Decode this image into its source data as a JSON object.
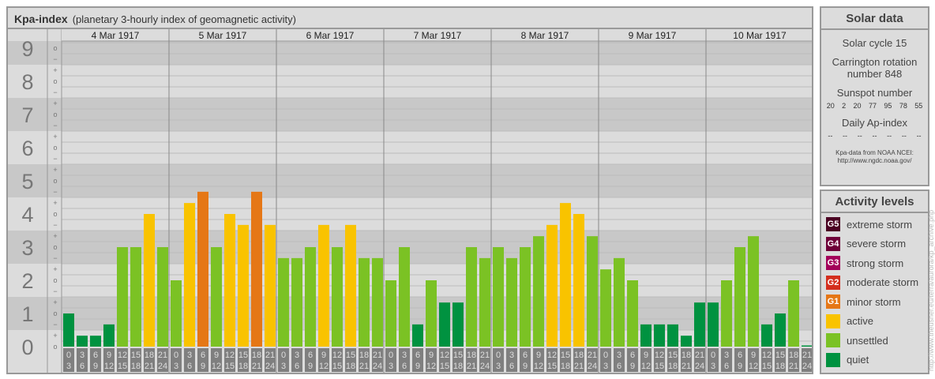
{
  "header": {
    "title": "Kpa-index",
    "subtitle": "(planetary 3-hourly index of geomagnetic activity)"
  },
  "chart_data": {
    "type": "bar",
    "title": "Kpa-index",
    "ylim": [
      0,
      9
    ],
    "y_ticks": [
      "0",
      "1",
      "2",
      "3",
      "4",
      "5",
      "6",
      "7",
      "8",
      "9"
    ],
    "y_subticks": [
      "o",
      "+",
      "−"
    ],
    "days": [
      "4 Mar 1917",
      "5 Mar 1917",
      "6 Mar 1917",
      "7 Mar 1917",
      "8 Mar 1917",
      "9 Mar 1917",
      "10 Mar 1917"
    ],
    "hour_labels": [
      [
        "0",
        "3"
      ],
      [
        "3",
        "6"
      ],
      [
        "6",
        "9"
      ],
      [
        "9",
        "12"
      ],
      [
        "12",
        "15"
      ],
      [
        "15",
        "18"
      ],
      [
        "18",
        "21"
      ],
      [
        "21",
        "24"
      ]
    ],
    "values": [
      [
        1.0,
        0.33,
        0.33,
        0.67,
        3.0,
        3.0,
        4.0,
        3.0
      ],
      [
        2.0,
        4.33,
        4.67,
        3.0,
        4.0,
        3.67,
        4.67,
        3.67
      ],
      [
        2.67,
        2.67,
        3.0,
        3.67,
        3.0,
        3.67,
        2.67,
        2.67
      ],
      [
        2.0,
        3.0,
        0.67,
        2.0,
        1.33,
        1.33,
        3.0,
        2.67
      ],
      [
        3.0,
        2.67,
        3.0,
        3.33,
        3.67,
        4.33,
        4.0,
        3.33
      ],
      [
        2.33,
        2.67,
        2.0,
        0.67,
        0.67,
        0.67,
        0.33,
        1.33
      ],
      [
        1.33,
        2.0,
        3.0,
        3.33,
        0.67,
        1.0,
        2.0,
        0.0
      ]
    ]
  },
  "solar": {
    "title": "Solar data",
    "cycle": "Solar cycle 15",
    "carrington": "Carrington rotation number 848",
    "sunspot_label": "Sunspot number",
    "sunspots": [
      "20",
      "2",
      "20",
      "77",
      "95",
      "78",
      "55"
    ],
    "ap_label": "Daily Ap-index",
    "ap": [
      "--",
      "--",
      "--",
      "--",
      "--",
      "--",
      "--"
    ],
    "source1": "Kpa-data from NOAA NCEI:",
    "source2": "http://www.ngdc.noaa.gov/"
  },
  "legend": {
    "title": "Activity levels",
    "items": [
      {
        "badge": "G5",
        "label": "extreme storm",
        "color": "#4a0022"
      },
      {
        "badge": "G4",
        "label": "severe storm",
        "color": "#6e0038"
      },
      {
        "badge": "G3",
        "label": "strong storm",
        "color": "#a3005a"
      },
      {
        "badge": "G2",
        "label": "moderate storm",
        "color": "#d42e1e"
      },
      {
        "badge": "G1",
        "label": "minor storm",
        "color": "#e57716"
      },
      {
        "badge": "",
        "label": "active",
        "color": "#f9c300"
      },
      {
        "badge": "",
        "label": "unsettled",
        "color": "#7bc224"
      },
      {
        "badge": "",
        "label": "quiet",
        "color": "#009240"
      }
    ]
  },
  "watermark": "http://www.theusner.eu/terra/aurora/kp_archive.php"
}
